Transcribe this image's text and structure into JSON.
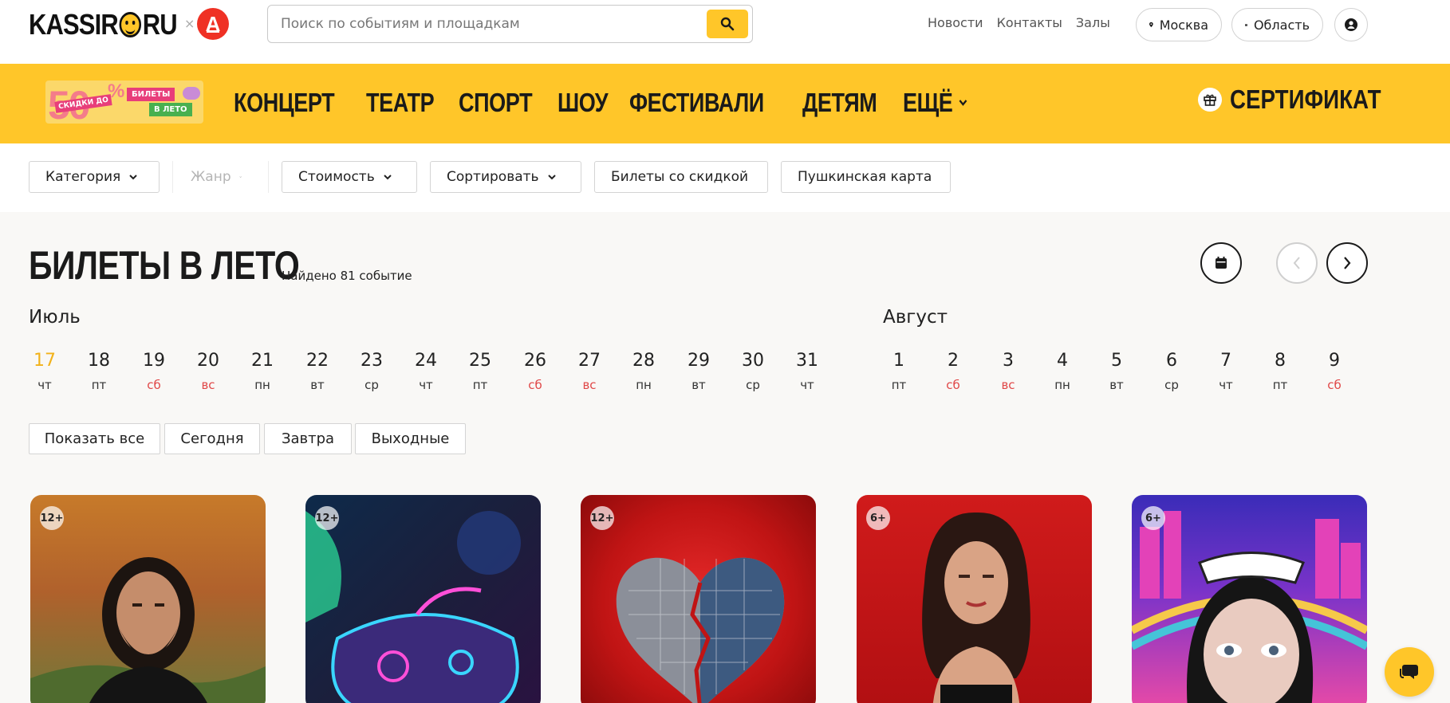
{
  "header": {
    "logo_text_left": "KASSIR",
    "logo_text_right": "RU",
    "partner_separator": "×",
    "partner_letter": "А",
    "search_placeholder": "Поиск по событиям и площадкам",
    "links": [
      "Новости",
      "Контакты",
      "Залы"
    ],
    "city": "Москва",
    "region": "Область"
  },
  "nav": {
    "promo": {
      "big": "50",
      "pct": "%",
      "discount": "СКИДКИ ДО",
      "tickets": "БИЛЕТЫ",
      "summer": "В ЛЕТО"
    },
    "items": [
      "КОНЦЕРТ",
      "ТЕАТР",
      "СПОРТ",
      "ШОУ",
      "ФЕСТИВАЛИ",
      "ДЕТЯМ",
      "ЕЩЁ"
    ],
    "certificate": "СЕРТИФИКАТ"
  },
  "filters": {
    "category": "Категория",
    "genre": "Жанр",
    "price": "Стоимость",
    "sort": "Сортировать",
    "discount": "Билеты со скидкой",
    "pushkin": "Пушкинская карта"
  },
  "page": {
    "title": "БИЛЕТЫ В ЛЕТО",
    "found": "Найдено 81 событие"
  },
  "calendar": {
    "months": [
      "Июль",
      "Август"
    ],
    "days": [
      {
        "n": "17",
        "w": "чт",
        "today": true
      },
      {
        "n": "18",
        "w": "пт"
      },
      {
        "n": "19",
        "w": "сб",
        "weekend": true
      },
      {
        "n": "20",
        "w": "вс",
        "weekend": true
      },
      {
        "n": "21",
        "w": "пн"
      },
      {
        "n": "22",
        "w": "вт"
      },
      {
        "n": "23",
        "w": "ср"
      },
      {
        "n": "24",
        "w": "чт"
      },
      {
        "n": "25",
        "w": "пт"
      },
      {
        "n": "26",
        "w": "сб",
        "weekend": true
      },
      {
        "n": "27",
        "w": "вс",
        "weekend": true
      },
      {
        "n": "28",
        "w": "пн"
      },
      {
        "n": "29",
        "w": "вт"
      },
      {
        "n": "30",
        "w": "ср"
      },
      {
        "n": "31",
        "w": "чт"
      },
      {
        "n": "1",
        "w": "пт"
      },
      {
        "n": "2",
        "w": "сб",
        "weekend": true
      },
      {
        "n": "3",
        "w": "вс",
        "weekend": true
      },
      {
        "n": "4",
        "w": "пн"
      },
      {
        "n": "5",
        "w": "вт"
      },
      {
        "n": "6",
        "w": "ср"
      },
      {
        "n": "7",
        "w": "чт"
      },
      {
        "n": "8",
        "w": "пт"
      },
      {
        "n": "9",
        "w": "сб",
        "weekend": true
      }
    ],
    "quick": [
      "Показать все",
      "Сегодня",
      "Завтра",
      "Выходные"
    ]
  },
  "cards": [
    {
      "age": "12+",
      "image": "bearded-man-portrait"
    },
    {
      "age": "12+",
      "image": "neon-gamepad"
    },
    {
      "age": "12+",
      "image": "broken-disco-heart"
    },
    {
      "age": "6+",
      "image": "woman-on-red"
    },
    {
      "age": "6+",
      "image": "pop-art-face"
    }
  ],
  "colors": {
    "accent": "#ffc629",
    "weekend": "#e04848",
    "today": "#f2b21a"
  },
  "icons": [
    "search-icon",
    "location-pin-icon",
    "map-icon",
    "user-icon",
    "gift-icon",
    "chevron-down-icon",
    "calendar-icon",
    "chevron-left-icon",
    "chevron-right-icon",
    "chat-icon"
  ]
}
